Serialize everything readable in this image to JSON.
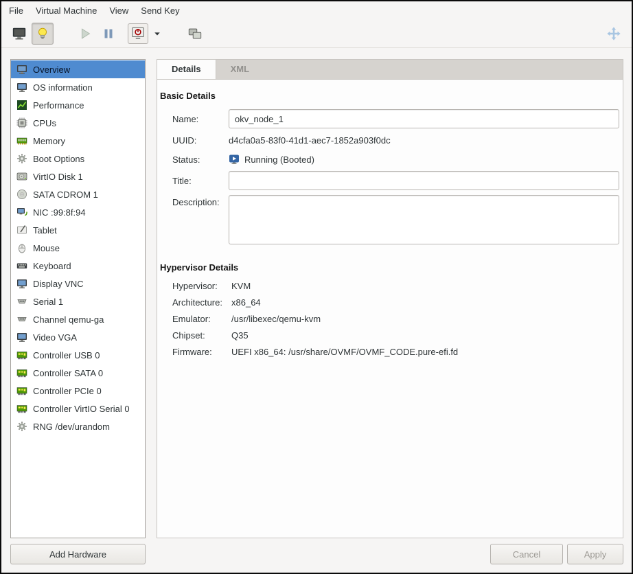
{
  "menubar": {
    "items": [
      "File",
      "Virtual Machine",
      "View",
      "Send Key"
    ]
  },
  "toolbar": {
    "buttons": [
      {
        "name": "show-console",
        "icon": "console-monitor-icon"
      },
      {
        "name": "show-hardware-details",
        "icon": "lightbulb-icon",
        "pressed": true
      },
      {
        "name": "run",
        "icon": "play-icon",
        "disabled": true
      },
      {
        "name": "pause",
        "icon": "pause-icon"
      },
      {
        "name": "shutdown",
        "icon": "shutdown-icon"
      },
      {
        "name": "shutdown-menu",
        "icon": "chevron-down-icon"
      },
      {
        "name": "snapshots",
        "icon": "snapshots-icon"
      },
      {
        "name": "fullscreen",
        "icon": "fullscreen-arrows-icon",
        "disabled": true
      }
    ]
  },
  "sidebar": {
    "items": [
      {
        "id": "overview",
        "label": "Overview",
        "icon": "monitor",
        "selected": true
      },
      {
        "id": "os-information",
        "label": "OS information",
        "icon": "monitor"
      },
      {
        "id": "performance",
        "label": "Performance",
        "icon": "chart"
      },
      {
        "id": "cpus",
        "label": "CPUs",
        "icon": "cpu"
      },
      {
        "id": "memory",
        "label": "Memory",
        "icon": "memory"
      },
      {
        "id": "boot-options",
        "label": "Boot Options",
        "icon": "gear"
      },
      {
        "id": "virtio-disk-1",
        "label": "VirtIO Disk 1",
        "icon": "disk"
      },
      {
        "id": "sata-cdrom-1",
        "label": "SATA CDROM 1",
        "icon": "cdrom"
      },
      {
        "id": "nic-99-8f-94",
        "label": "NIC :99:8f:94",
        "icon": "network"
      },
      {
        "id": "tablet",
        "label": "Tablet",
        "icon": "tablet"
      },
      {
        "id": "mouse",
        "label": "Mouse",
        "icon": "mouse"
      },
      {
        "id": "keyboard",
        "label": "Keyboard",
        "icon": "keyboard"
      },
      {
        "id": "display-vnc",
        "label": "Display VNC",
        "icon": "monitor"
      },
      {
        "id": "serial-1",
        "label": "Serial 1",
        "icon": "serial"
      },
      {
        "id": "channel-qemu-ga",
        "label": "Channel qemu-ga",
        "icon": "serial"
      },
      {
        "id": "video-vga",
        "label": "Video VGA",
        "icon": "monitor"
      },
      {
        "id": "controller-usb-0",
        "label": "Controller USB 0",
        "icon": "board"
      },
      {
        "id": "controller-sata-0",
        "label": "Controller SATA 0",
        "icon": "board"
      },
      {
        "id": "controller-pcie-0",
        "label": "Controller PCIe 0",
        "icon": "board"
      },
      {
        "id": "controller-virtio-serial-0",
        "label": "Controller VirtIO Serial 0",
        "icon": "board"
      },
      {
        "id": "rng-dev-urandom",
        "label": "RNG /dev/urandom",
        "icon": "gear"
      }
    ],
    "add_hardware_label": "Add Hardware"
  },
  "tabs": [
    {
      "label": "Details",
      "active": true
    },
    {
      "label": "XML",
      "active": false
    }
  ],
  "details": {
    "basic": {
      "title": "Basic Details",
      "name_label": "Name:",
      "name_value": "okv_node_1",
      "uuid_label": "UUID:",
      "uuid_value": "d4cfa0a5-83f0-41d1-aec7-1852a903f0dc",
      "status_label": "Status:",
      "status_value": "Running (Booted)",
      "status_icon": "vm-running-icon",
      "title_label": "Title:",
      "title_value": "",
      "description_label": "Description:",
      "description_value": ""
    },
    "hypervisor": {
      "title": "Hypervisor Details",
      "rows": [
        {
          "label": "Hypervisor:",
          "value": "KVM"
        },
        {
          "label": "Architecture:",
          "value": "x86_64"
        },
        {
          "label": "Emulator:",
          "value": "/usr/libexec/qemu-kvm"
        },
        {
          "label": "Chipset:",
          "value": "Q35"
        },
        {
          "label": "Firmware:",
          "value": "UEFI x86_64: /usr/share/OVMF/OVMF_CODE.pure-efi.fd"
        }
      ]
    }
  },
  "footer": {
    "cancel_label": "Cancel",
    "apply_label": "Apply"
  },
  "colors": {
    "selection": "#4f8bd0",
    "window_bg": "#f6f5f4",
    "status_icon_blue": "#3465a4"
  }
}
